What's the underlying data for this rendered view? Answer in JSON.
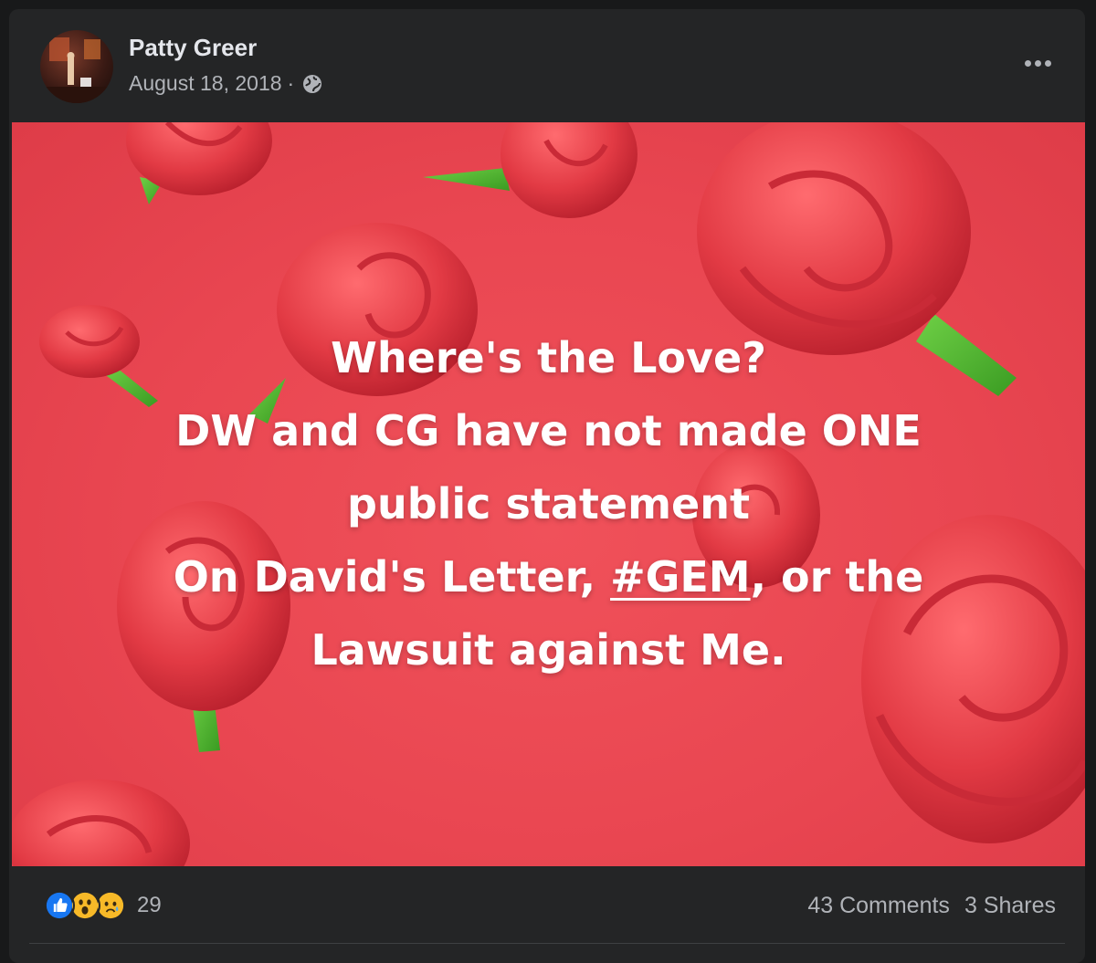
{
  "post": {
    "author": "Patty Greer",
    "date": "August 18, 2018",
    "separator": "·",
    "audience_icon": "globe-icon",
    "more_icon": "more-options-icon"
  },
  "image": {
    "background_color": "#e94651",
    "lines": [
      "Where's the Love?",
      "DW and CG have not made ONE",
      "public statement"
    ],
    "line4_before": "On David's Letter, ",
    "line4_hashtag": "#GEM",
    "line4_after": ", or the",
    "line5": "Lawsuit against Me."
  },
  "footer": {
    "reactions": [
      "like-reaction-icon",
      "wow-reaction-icon",
      "sad-reaction-icon"
    ],
    "reaction_count": "29",
    "comments": "43 Comments",
    "shares": "3 Shares"
  },
  "colors": {
    "card": "#242526",
    "text_primary": "#e4e6eb",
    "text_secondary": "#b0b3b8",
    "like_blue": "#1877f2",
    "emoji_yellow": "#f7b928"
  }
}
